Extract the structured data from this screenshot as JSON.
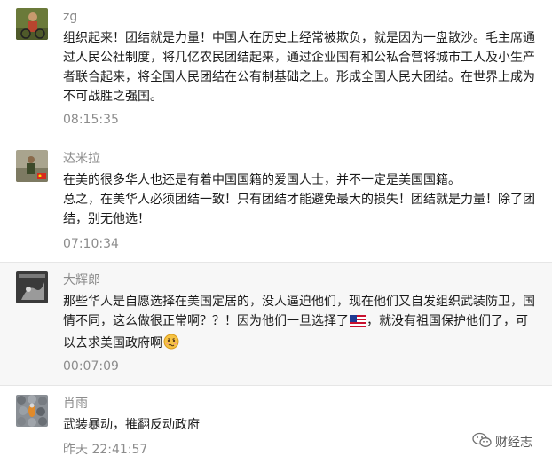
{
  "comments": [
    {
      "name": "zg",
      "text_lines": [
        "组织起来！团结就是力量！中国人在历史上经常被欺负，就是因为一盘散沙。毛主席通过人民公社制度，将几亿农民团结起来，通过企业国有和公私合营将城市工人及小生产者联合起来，将全国人民团结在公有制基础之上。形成全国人民大团结。在世界上成为不可战胜之强国。"
      ],
      "time": "08:15:35"
    },
    {
      "name": "达米拉",
      "text_lines": [
        "在美的很多华人也还是有着中国国籍的爱国人士，并不一定是美国国籍。",
        "总之，在美华人必须团结一致！只有团结才能避免最大的损失！团结就是力量！除了团结，别无他选！"
      ],
      "time": "07:10:34"
    },
    {
      "name": "大辉郎",
      "text_before_flag": "那些华人是自愿选择在美国定居的，没人逼迫他们，现在他们又自发组织武装防卫，国情不同，这么做很正常啊？？！因为他们一旦选择了",
      "text_after_flag": "，就没有祖国保护他们了，可以去求美国政府啊",
      "time": "00:07:09"
    },
    {
      "name": "肖雨",
      "text_lines": [
        "武装暴动，推翻反动政府"
      ],
      "time": "昨天 22:41:57"
    }
  ],
  "icons": {
    "flag": "us-flag-emoji-icon",
    "face": "anxious-face-emoji-icon",
    "brand": "wechat-icon"
  },
  "brand": {
    "label": "财经志"
  },
  "colors": {
    "alt_background": "#f7f7f7",
    "meta_text": "#8c8c8c",
    "body_text": "#1a1a1a"
  }
}
